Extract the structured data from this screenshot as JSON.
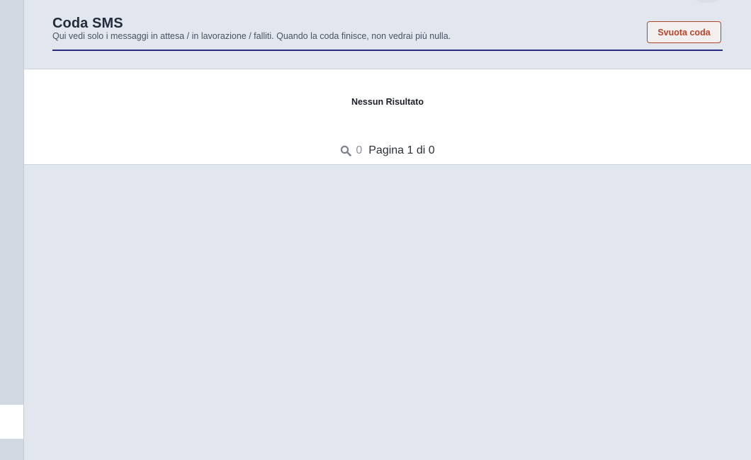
{
  "header": {
    "title": "Coda SMS",
    "subtitle": "Qui vedi solo i messaggi in attesa / in lavorazione / falliti. Quando la coda finisce, non vedrai più nulla.",
    "empty_queue_label": "Svuota coda"
  },
  "results": {
    "empty_text": "Nessun Risultato",
    "count": "0",
    "page_text": "Pagina 1 di 0"
  },
  "colors": {
    "accent_underline": "#2d2a86",
    "danger": "#b3442a",
    "background": "#e2e6ee"
  },
  "icons": {
    "search": "search-icon"
  }
}
